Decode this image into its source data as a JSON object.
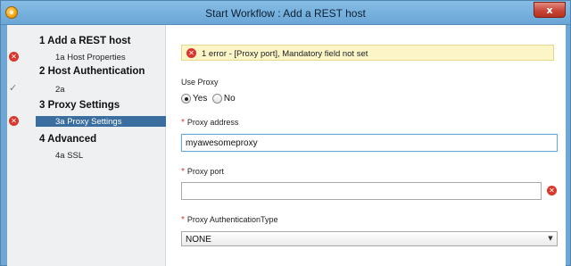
{
  "window": {
    "title": "Start Workflow : Add a REST host",
    "close_label": "x"
  },
  "sidebar": {
    "steps": [
      {
        "title": "1 Add a REST host",
        "sub": "1a  Host Properties",
        "status": "error"
      },
      {
        "title": "2 Host Authentication",
        "sub": "2a",
        "status": "done"
      },
      {
        "title": "3 Proxy Settings",
        "sub": "3a  Proxy Settings",
        "status": "error",
        "selected": true
      },
      {
        "title": "4 Advanced",
        "sub": "4a  SSL",
        "status": "none"
      }
    ],
    "icons": {
      "error": "error-x-icon",
      "done": "checkmark-icon"
    }
  },
  "form": {
    "error_banner": "1 error - [Proxy port], Mandatory field not set",
    "use_proxy": {
      "label": "Use Proxy",
      "options": [
        "Yes",
        "No"
      ],
      "selected": "Yes"
    },
    "proxy_address": {
      "label": "Proxy address",
      "value": "myawesomeproxy",
      "required": true
    },
    "proxy_port": {
      "label": "Proxy port",
      "value": "",
      "required": true,
      "error": true
    },
    "proxy_auth_type": {
      "label": "Proxy AuthenticationType",
      "value": "NONE",
      "required": true
    }
  },
  "colors": {
    "titlebar": "#6aa6d6",
    "error_red": "#d9362c",
    "selected_step": "#3a6e9e",
    "banner_bg": "#fbf5c8"
  }
}
